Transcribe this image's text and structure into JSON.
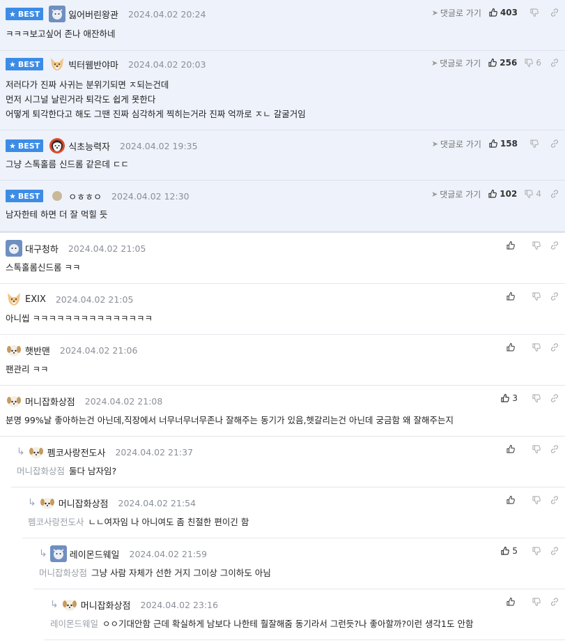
{
  "best_label": "BEST",
  "goto_label": "댓글로 가기",
  "best": [
    {
      "nick": "잃어버린왕관",
      "date": "2024.04.02 20:24",
      "likes": "403",
      "dislikes": "",
      "lines": [
        "ㅋㅋㅋ보고싶어 존나 애잔하네"
      ]
    },
    {
      "nick": "빅터웸반야마",
      "date": "2024.04.02 20:03",
      "likes": "256",
      "dislikes": "6",
      "lines": [
        "저러다가 진짜 사귀는 분위기되면 ㅈ되는건데",
        "먼저 시그널 날린거라 퇴각도 쉽게 못한다",
        "어떻게 퇴각한다고 해도 그땐 진짜 심각하게 찍히는거라 진짜 억까로 ㅈㄴ 갈굴거임"
      ]
    },
    {
      "nick": "식초능력자",
      "date": "2024.04.02 19:35",
      "likes": "158",
      "dislikes": "",
      "lines": [
        "그냥 스톡홀름 신드롬 같은데 ㄷㄷ"
      ]
    },
    {
      "nick": "ㅇㅎㅎㅇ",
      "date": "2024.04.02 12:30",
      "likes": "102",
      "dislikes": "4",
      "lines": [
        "남자한테 하면 더 잘 먹힐 듯"
      ]
    }
  ],
  "comments": [
    {
      "nick": "대구청하",
      "date": "2024.04.02 21:05",
      "likes": "",
      "mention": "",
      "text": "스톡홀롬신드롬 ㅋㅋ"
    },
    {
      "nick": "EXIX",
      "date": "2024.04.02 21:05",
      "likes": "",
      "mention": "",
      "text": "아니씹 ㅋㅋㅋㅋㅋㅋㅋㅋㅋㅋㅋㅋㅋㅋㅋ"
    },
    {
      "nick": "햇반맨",
      "date": "2024.04.02 21:06",
      "likes": "",
      "mention": "",
      "text": "팬관리 ㅋㅋ"
    },
    {
      "nick": "머니잡화상점",
      "date": "2024.04.02 21:08",
      "likes": "3",
      "mention": "",
      "text": "분명 99%날 좋아하는건 아닌데,직장에서 너무너무너무존나 잘해주는 동기가 있음,헷갈리는건 아닌데 궁금함 왜 잘해주는지"
    },
    {
      "nick": "펨코사랑전도사",
      "date": "2024.04.02 21:37",
      "likes": "",
      "mention": "머니잡화상점",
      "text": "둘다 남자임?"
    },
    {
      "nick": "머니잡화상점",
      "date": "2024.04.02 21:54",
      "likes": "",
      "mention": "펨코사랑전도사",
      "text": "ㄴㄴ여자임 나 아니여도 좀 친절한 편이긴 함"
    },
    {
      "nick": "레이몬드웨일",
      "date": "2024.04.02 21:59",
      "likes": "5",
      "mention": "머니잡화상점",
      "text": "그냥 사람 자체가 선한 거지 그이상 그이하도 아님"
    },
    {
      "nick": "머니잡화상점",
      "date": "2024.04.02 23:16",
      "likes": "",
      "mention": "레이몬드웨일",
      "text": "ㅇㅇ기대안함 근데 확실하게 남보다 나한테 훨잘해줌 동기라서 그런듯?나 좋아할까?이런 생각1도 안함"
    }
  ]
}
